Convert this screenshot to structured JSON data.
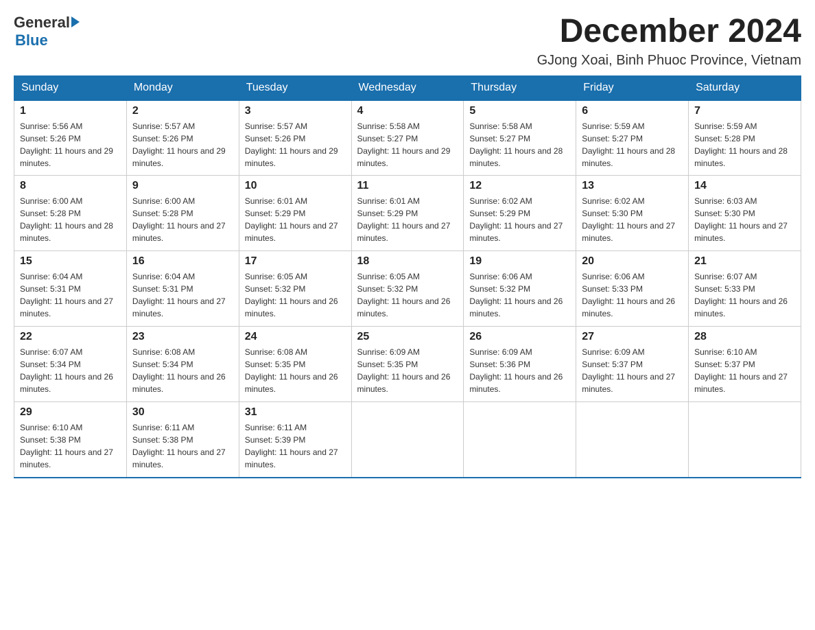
{
  "logo": {
    "general": "General",
    "arrow": "▶",
    "blue": "Blue"
  },
  "title": "December 2024",
  "location": "GJong Xoai, Binh Phuoc Province, Vietnam",
  "days_of_week": [
    "Sunday",
    "Monday",
    "Tuesday",
    "Wednesday",
    "Thursday",
    "Friday",
    "Saturday"
  ],
  "weeks": [
    [
      {
        "day": "1",
        "sunrise": "5:56 AM",
        "sunset": "5:26 PM",
        "daylight": "11 hours and 29 minutes."
      },
      {
        "day": "2",
        "sunrise": "5:57 AM",
        "sunset": "5:26 PM",
        "daylight": "11 hours and 29 minutes."
      },
      {
        "day": "3",
        "sunrise": "5:57 AM",
        "sunset": "5:26 PM",
        "daylight": "11 hours and 29 minutes."
      },
      {
        "day": "4",
        "sunrise": "5:58 AM",
        "sunset": "5:27 PM",
        "daylight": "11 hours and 29 minutes."
      },
      {
        "day": "5",
        "sunrise": "5:58 AM",
        "sunset": "5:27 PM",
        "daylight": "11 hours and 28 minutes."
      },
      {
        "day": "6",
        "sunrise": "5:59 AM",
        "sunset": "5:27 PM",
        "daylight": "11 hours and 28 minutes."
      },
      {
        "day": "7",
        "sunrise": "5:59 AM",
        "sunset": "5:28 PM",
        "daylight": "11 hours and 28 minutes."
      }
    ],
    [
      {
        "day": "8",
        "sunrise": "6:00 AM",
        "sunset": "5:28 PM",
        "daylight": "11 hours and 28 minutes."
      },
      {
        "day": "9",
        "sunrise": "6:00 AM",
        "sunset": "5:28 PM",
        "daylight": "11 hours and 27 minutes."
      },
      {
        "day": "10",
        "sunrise": "6:01 AM",
        "sunset": "5:29 PM",
        "daylight": "11 hours and 27 minutes."
      },
      {
        "day": "11",
        "sunrise": "6:01 AM",
        "sunset": "5:29 PM",
        "daylight": "11 hours and 27 minutes."
      },
      {
        "day": "12",
        "sunrise": "6:02 AM",
        "sunset": "5:29 PM",
        "daylight": "11 hours and 27 minutes."
      },
      {
        "day": "13",
        "sunrise": "6:02 AM",
        "sunset": "5:30 PM",
        "daylight": "11 hours and 27 minutes."
      },
      {
        "day": "14",
        "sunrise": "6:03 AM",
        "sunset": "5:30 PM",
        "daylight": "11 hours and 27 minutes."
      }
    ],
    [
      {
        "day": "15",
        "sunrise": "6:04 AM",
        "sunset": "5:31 PM",
        "daylight": "11 hours and 27 minutes."
      },
      {
        "day": "16",
        "sunrise": "6:04 AM",
        "sunset": "5:31 PM",
        "daylight": "11 hours and 27 minutes."
      },
      {
        "day": "17",
        "sunrise": "6:05 AM",
        "sunset": "5:32 PM",
        "daylight": "11 hours and 26 minutes."
      },
      {
        "day": "18",
        "sunrise": "6:05 AM",
        "sunset": "5:32 PM",
        "daylight": "11 hours and 26 minutes."
      },
      {
        "day": "19",
        "sunrise": "6:06 AM",
        "sunset": "5:32 PM",
        "daylight": "11 hours and 26 minutes."
      },
      {
        "day": "20",
        "sunrise": "6:06 AM",
        "sunset": "5:33 PM",
        "daylight": "11 hours and 26 minutes."
      },
      {
        "day": "21",
        "sunrise": "6:07 AM",
        "sunset": "5:33 PM",
        "daylight": "11 hours and 26 minutes."
      }
    ],
    [
      {
        "day": "22",
        "sunrise": "6:07 AM",
        "sunset": "5:34 PM",
        "daylight": "11 hours and 26 minutes."
      },
      {
        "day": "23",
        "sunrise": "6:08 AM",
        "sunset": "5:34 PM",
        "daylight": "11 hours and 26 minutes."
      },
      {
        "day": "24",
        "sunrise": "6:08 AM",
        "sunset": "5:35 PM",
        "daylight": "11 hours and 26 minutes."
      },
      {
        "day": "25",
        "sunrise": "6:09 AM",
        "sunset": "5:35 PM",
        "daylight": "11 hours and 26 minutes."
      },
      {
        "day": "26",
        "sunrise": "6:09 AM",
        "sunset": "5:36 PM",
        "daylight": "11 hours and 26 minutes."
      },
      {
        "day": "27",
        "sunrise": "6:09 AM",
        "sunset": "5:37 PM",
        "daylight": "11 hours and 27 minutes."
      },
      {
        "day": "28",
        "sunrise": "6:10 AM",
        "sunset": "5:37 PM",
        "daylight": "11 hours and 27 minutes."
      }
    ],
    [
      {
        "day": "29",
        "sunrise": "6:10 AM",
        "sunset": "5:38 PM",
        "daylight": "11 hours and 27 minutes."
      },
      {
        "day": "30",
        "sunrise": "6:11 AM",
        "sunset": "5:38 PM",
        "daylight": "11 hours and 27 minutes."
      },
      {
        "day": "31",
        "sunrise": "6:11 AM",
        "sunset": "5:39 PM",
        "daylight": "11 hours and 27 minutes."
      },
      null,
      null,
      null,
      null
    ]
  ]
}
